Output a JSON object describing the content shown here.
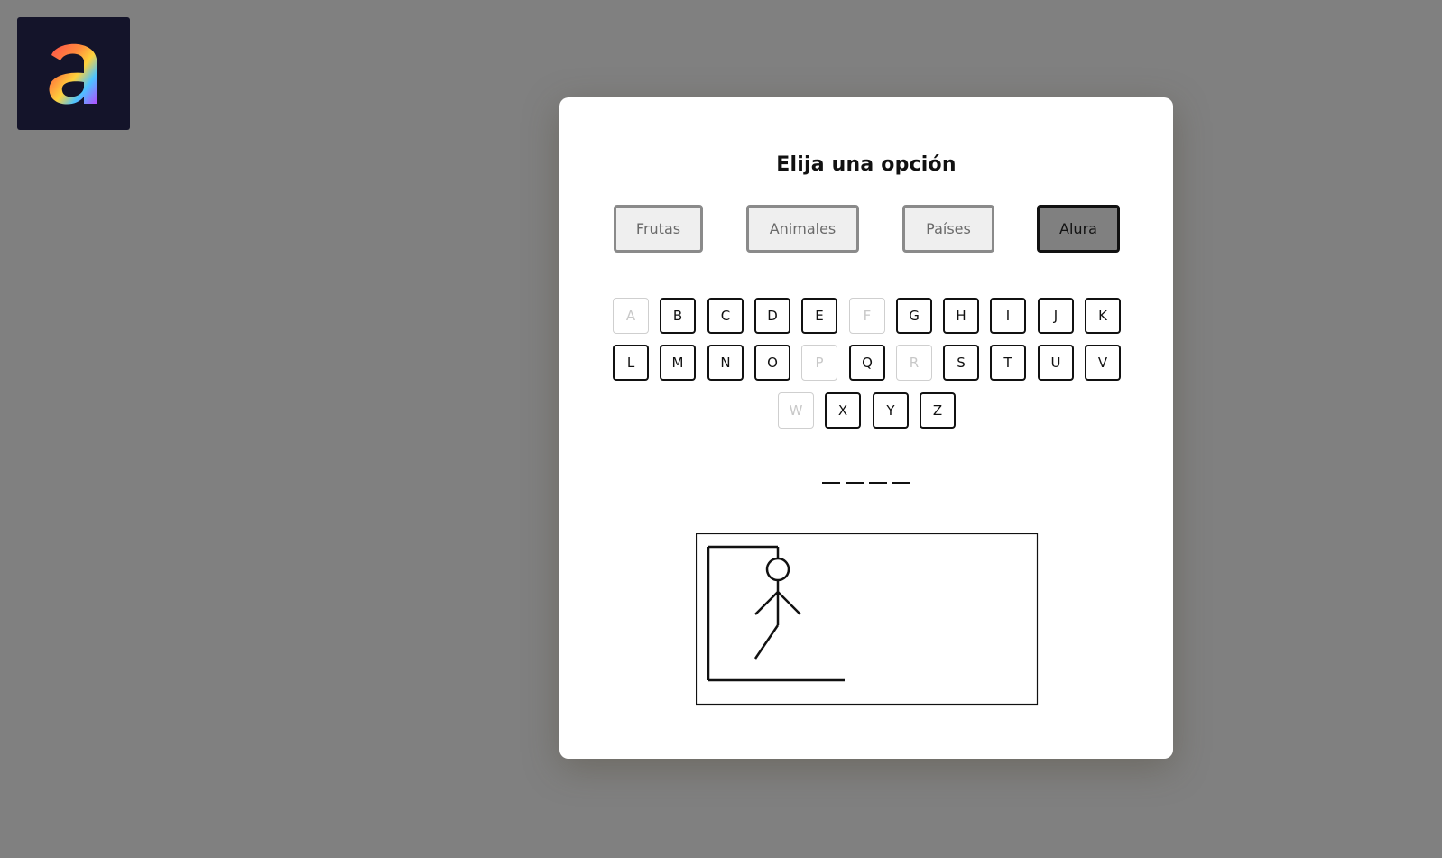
{
  "logo": {
    "name": "alura-logo",
    "background": "#14142a"
  },
  "modal": {
    "title": "Elija una opción"
  },
  "categories": [
    {
      "label": "Frutas",
      "selected": false
    },
    {
      "label": "Animales",
      "selected": false
    },
    {
      "label": "Países",
      "selected": false
    },
    {
      "label": "Alura",
      "selected": true
    }
  ],
  "keyboard": {
    "rows": [
      [
        "A",
        "B",
        "C",
        "D",
        "E",
        "F",
        "G",
        "H",
        "I",
        "J",
        "K"
      ],
      [
        "L",
        "M",
        "N",
        "O",
        "P",
        "Q",
        "R",
        "S",
        "T",
        "U",
        "V"
      ],
      [
        "W",
        "X",
        "Y",
        "Z"
      ]
    ],
    "used_letters": [
      "A",
      "F",
      "P",
      "R",
      "W"
    ]
  },
  "word": {
    "letter_count": 4,
    "revealed": [
      "",
      "",
      "",
      ""
    ]
  },
  "hangman": {
    "errors": 5,
    "parts_drawn": [
      "head",
      "body",
      "left-arm",
      "right-arm",
      "left-leg"
    ]
  },
  "colors": {
    "backdrop": "#808080",
    "selected_category": "#808080",
    "used_key": "#c8c8c8"
  }
}
